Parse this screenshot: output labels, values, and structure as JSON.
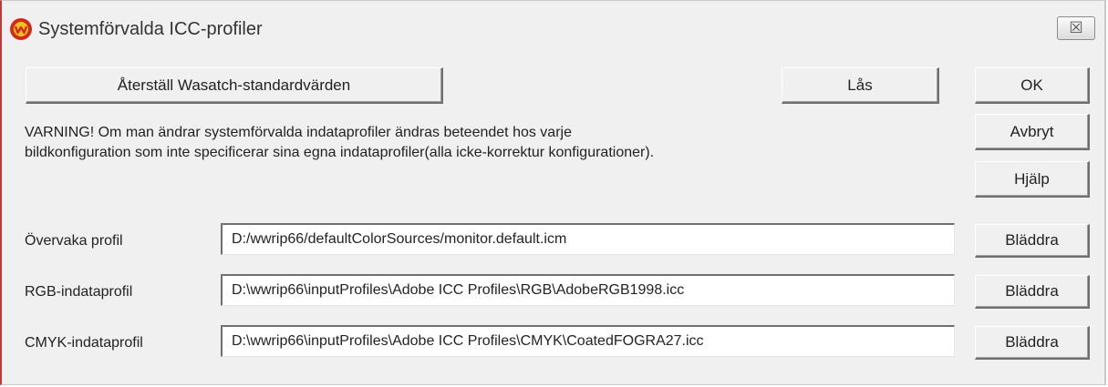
{
  "window": {
    "title": "Systemförvalda ICC-profiler",
    "close_symbol": "☒"
  },
  "buttons": {
    "restore": "Återställ Wasatch-standardvärden",
    "lock": "Lås",
    "ok": "OK",
    "cancel": "Avbryt",
    "help": "Hjälp"
  },
  "warning": {
    "line1": "VARNING!  Om man ändrar systemförvalda indataprofiler ändras beteendet hos varje",
    "line2": "bildkonfiguration som inte specificerar sina egna indataprofiler(alla icke-korrektur konfigurationer)."
  },
  "profiles": [
    {
      "label": "Övervaka profil",
      "value": "D:/wwrip66/defaultColorSources/monitor.default.icm",
      "browse": "Bläddra"
    },
    {
      "label": "RGB-indataprofil",
      "value": "D:\\wwrip66\\inputProfiles\\Adobe ICC Profiles\\RGB\\AdobeRGB1998.icc",
      "browse": "Bläddra"
    },
    {
      "label": "CMYK-indataprofil",
      "value": "D:\\wwrip66\\inputProfiles\\Adobe ICC Profiles\\CMYK\\CoatedFOGRA27.icc",
      "browse": "Bläddra"
    }
  ],
  "colors": {
    "app_icon_red": "#d42a1e",
    "app_icon_yellow": "#f4c21c"
  }
}
